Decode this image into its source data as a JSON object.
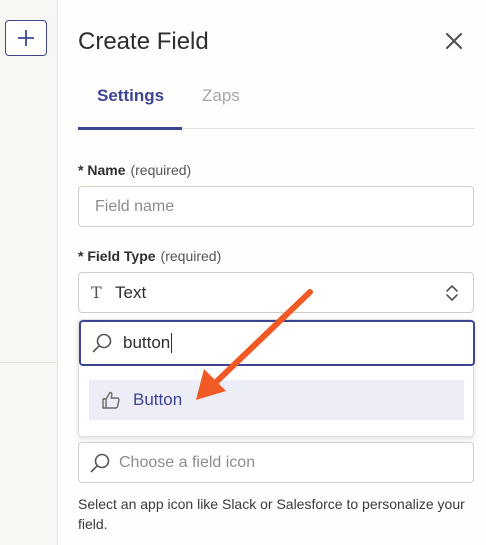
{
  "sidebar": {
    "add_icon": "plus-icon"
  },
  "panel": {
    "title": "Create Field",
    "close_icon": "close-icon",
    "tabs": [
      {
        "label": "Settings",
        "active": true
      },
      {
        "label": "Zaps",
        "active": false
      }
    ]
  },
  "form": {
    "name": {
      "label": "Name",
      "required_note": "(required)",
      "placeholder": "Field name",
      "value": ""
    },
    "field_type": {
      "label": "Field Type",
      "required_note": "(required)",
      "selected_icon_glyph": "T",
      "selected": "Text",
      "search_value": "button",
      "options": [
        {
          "label": "Button",
          "icon": "thumbs-up-icon",
          "highlighted": true
        }
      ]
    },
    "field_icon": {
      "placeholder": "Choose a field icon"
    },
    "help_text": "Select an app icon like Slack or Salesforce to personalize your field."
  },
  "annotation": {
    "arrow_color": "#f15a24"
  },
  "colors": {
    "accent": "#3d4592",
    "highlight": "#ecedf7"
  }
}
